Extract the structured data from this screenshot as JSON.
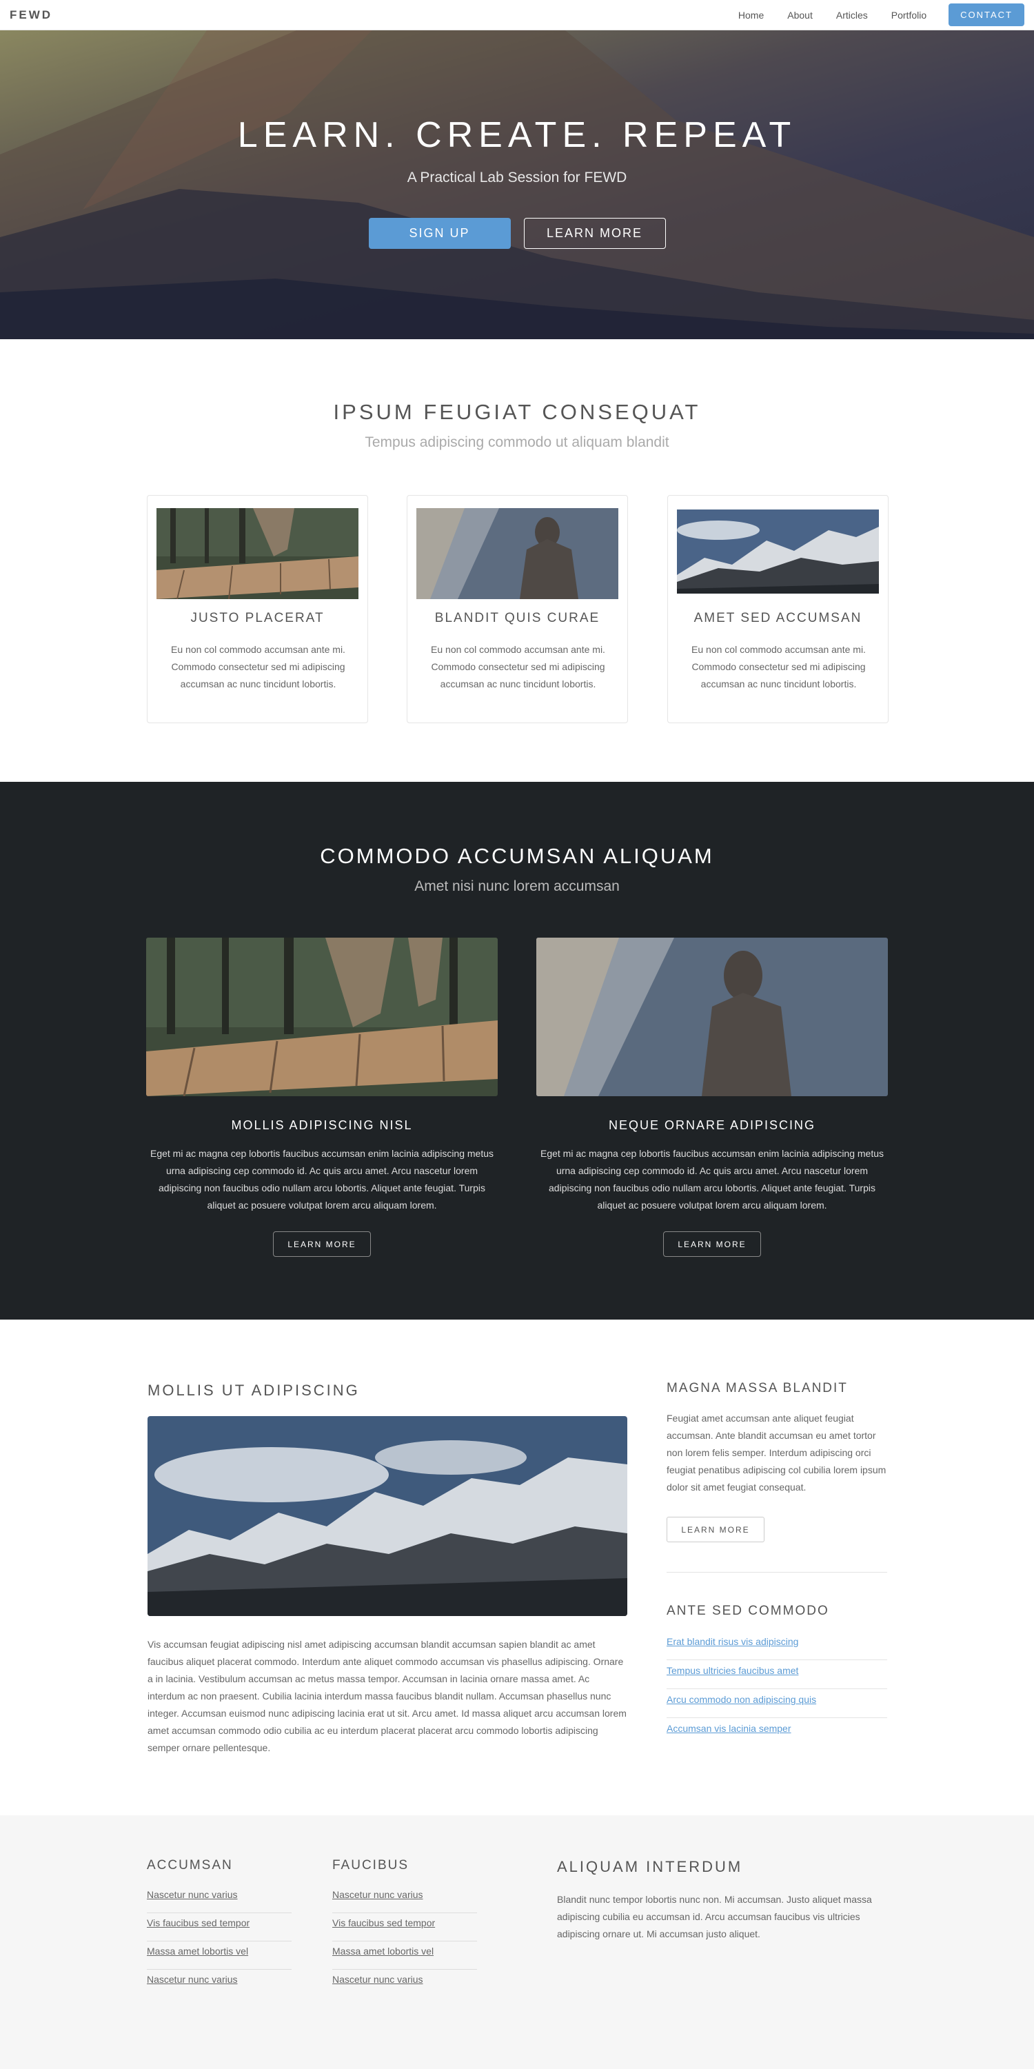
{
  "nav": {
    "brand": "FEWD",
    "links": [
      "Home",
      "About",
      "Articles",
      "Portfolio"
    ],
    "contact": "CONTACT"
  },
  "hero": {
    "title": "LEARN. CREATE. REPEAT",
    "subtitle": "A Practical Lab Session for FEWD",
    "primary_button": "SIGN UP",
    "secondary_button": "LEARN MORE"
  },
  "features": {
    "title": "IPSUM FEUGIAT CONSEQUAT",
    "subtitle": "Tempus adipiscing commodo ut aliquam blandit",
    "cards": [
      {
        "title": "JUSTO PLACERAT",
        "text": "Eu non col commodo accumsan ante mi. Commodo consectetur sed mi adipiscing accumsan ac nunc tincidunt lobortis.",
        "image": "boardwalk-photo"
      },
      {
        "title": "BLANDIT QUIS CURAE",
        "text": "Eu non col commodo accumsan ante mi. Commodo consectetur sed mi adipiscing accumsan ac nunc tincidunt lobortis.",
        "image": "hooded-person-photo"
      },
      {
        "title": "AMET SED ACCUMSAN",
        "text": "Eu non col commodo accumsan ante mi. Commodo consectetur sed mi adipiscing accumsan ac nunc tincidunt lobortis.",
        "image": "mountains-photo"
      }
    ]
  },
  "dark": {
    "title": "COMMODO ACCUMSAN ALIQUAM",
    "subtitle": "Amet nisi nunc lorem accumsan",
    "columns": [
      {
        "title": "MOLLIS ADIPISCING NISL",
        "text": "Eget mi ac magna cep lobortis faucibus accumsan enim lacinia adipiscing metus urna adipiscing cep commodo id. Ac quis arcu amet. Arcu nascetur lorem adipiscing non faucibus odio nullam arcu lobortis. Aliquet ante feugiat. Turpis aliquet ac posuere volutpat lorem arcu aliquam lorem.",
        "button": "LEARN MORE",
        "image": "boardwalk-photo"
      },
      {
        "title": "NEQUE ORNARE ADIPISCING",
        "text": "Eget mi ac magna cep lobortis faucibus accumsan enim lacinia adipiscing metus urna adipiscing cep commodo id. Ac quis arcu amet. Arcu nascetur lorem adipiscing non faucibus odio nullam arcu lobortis. Aliquet ante feugiat. Turpis aliquet ac posuere volutpat lorem arcu aliquam lorem.",
        "button": "LEARN MORE",
        "image": "hooded-person-photo"
      }
    ]
  },
  "main": {
    "title": "MOLLIS UT ADIPISCING",
    "image": "mountains-photo",
    "text": "Vis accumsan feugiat adipiscing nisl amet adipiscing accumsan blandit accumsan sapien blandit ac amet faucibus aliquet placerat commodo. Interdum ante aliquet commodo accumsan vis phasellus adipiscing. Ornare a in lacinia. Vestibulum accumsan ac metus massa tempor. Accumsan in lacinia ornare massa amet. Ac interdum ac non praesent. Cubilia lacinia interdum massa faucibus blandit nullam. Accumsan phasellus nunc integer. Accumsan euismod nunc adipiscing lacinia erat ut sit. Arcu amet. Id massa aliquet arcu accumsan lorem amet accumsan commodo odio cubilia ac eu interdum placerat placerat arcu commodo lobortis adipiscing semper ornare pellentesque."
  },
  "sidebar": {
    "title1": "MAGNA MASSA BLANDIT",
    "text": "Feugiat amet accumsan ante aliquet feugiat accumsan. Ante blandit accumsan eu amet tortor non lorem felis semper. Interdum adipiscing orci feugiat penatibus adipiscing col cubilia lorem ipsum dolor sit amet feugiat consequat.",
    "button": "LEARN MORE",
    "title2": "ANTE SED COMMODO",
    "links": [
      "Erat blandit risus vis adipiscing",
      "Tempus ultricies faucibus amet",
      "Arcu commodo non adipiscing quis",
      "Accumsan vis lacinia semper"
    ]
  },
  "footer": {
    "col1": {
      "title": "ACCUMSAN",
      "links": [
        "Nascetur nunc varius",
        "Vis faucibus sed tempor",
        "Massa amet lobortis vel",
        "Nascetur nunc varius"
      ]
    },
    "col2": {
      "title": "FAUCIBUS",
      "links": [
        "Nascetur nunc varius",
        "Vis faucibus sed tempor",
        "Massa amet lobortis vel",
        "Nascetur nunc varius"
      ]
    },
    "col3": {
      "title": "ALIQUAM INTERDUM",
      "text": "Blandit nunc tempor lobortis nunc non. Mi accumsan. Justo aliquet massa adipiscing cubilia eu accumsan id. Arcu accumsan faucibus vis ultricies adipiscing ornare ut. Mi accumsan justo aliquet."
    }
  },
  "colors": {
    "accent": "#5b9bd5",
    "dark_bg": "#1f2326",
    "footer_bg": "#f6f6f6"
  }
}
